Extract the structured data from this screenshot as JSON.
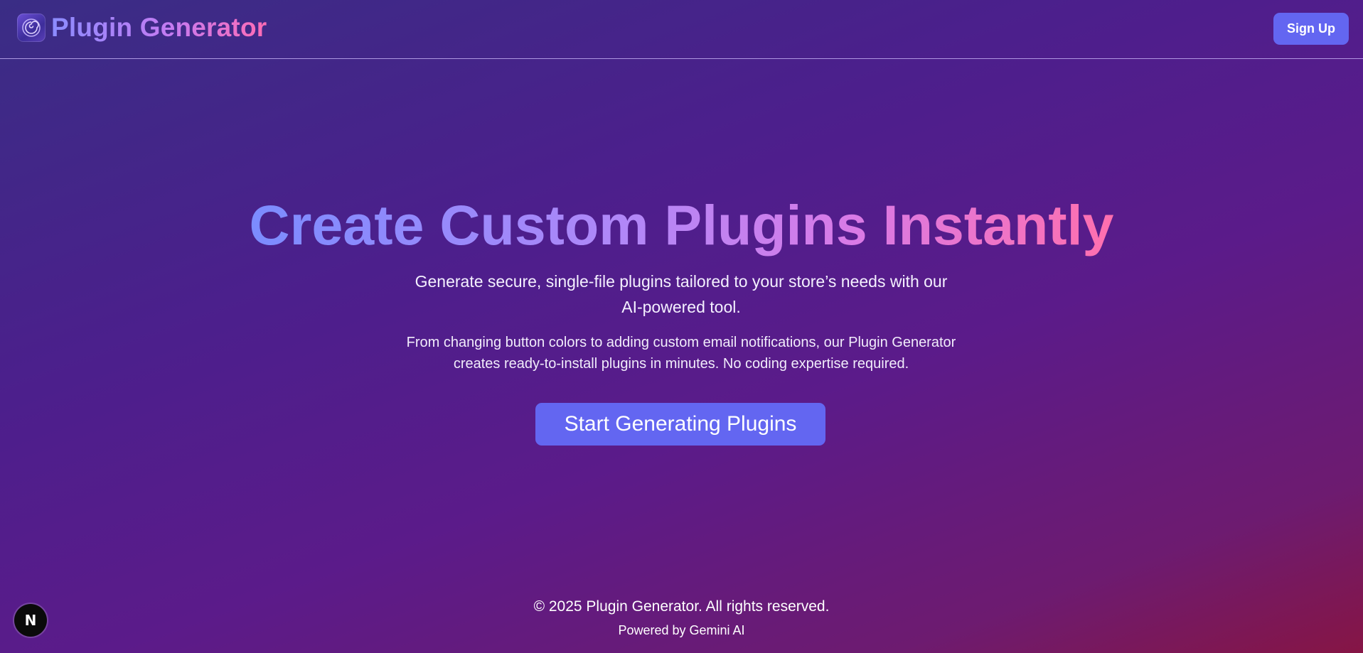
{
  "header": {
    "logo_icon": "spiral-g-logo-icon",
    "brand": "Plugin Generator",
    "signup_label": "Sign Up"
  },
  "hero": {
    "title": "Create Custom Plugins Instantly",
    "subtitle_line1": "Generate secure, single-file plugins tailored to your store’s needs with our",
    "subtitle_line2": "AI-powered tool.",
    "desc_line1": "From changing button colors to adding custom email notifications, our Plugin Generator",
    "desc_line2": "creates ready-to-install plugins in minutes. No coding expertise required.",
    "cta_label": "Start Generating Plugins"
  },
  "footer": {
    "copyright": "© 2025 Plugin Generator. All rights reserved.",
    "powered": "Powered by Gemini AI"
  },
  "dev_badge": {
    "letter": "N",
    "icon": "nextjs-dev-indicator-icon"
  },
  "colors": {
    "accent": "#6366f1",
    "gradient_start": "#7b8cff",
    "gradient_end": "#ff6fae",
    "background_top": "#3a2d85",
    "background_bottom": "#861545"
  }
}
